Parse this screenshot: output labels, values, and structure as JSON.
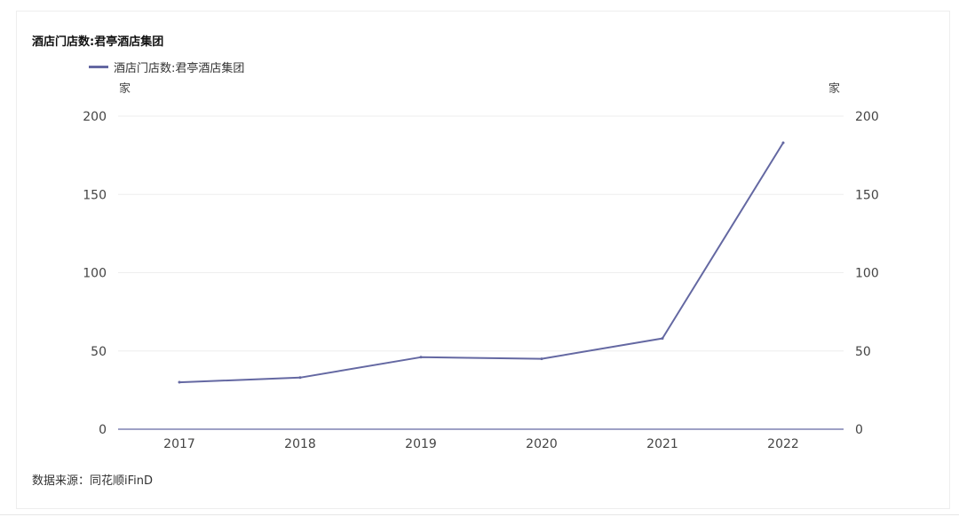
{
  "chart_data": {
    "type": "line",
    "title": "酒店门店数:君亭酒店集团",
    "xlabel": "",
    "ylabel_left": "家",
    "ylabel_right": "家",
    "categories": [
      "2017",
      "2018",
      "2019",
      "2020",
      "2021",
      "2022"
    ],
    "series": [
      {
        "name": "酒店门店数:君亭酒店集团",
        "values": [
          30,
          33,
          46,
          45,
          58,
          183
        ],
        "color": "#6468a2"
      }
    ],
    "ylim": [
      0,
      200
    ],
    "yticks": [
      0,
      50,
      100,
      150,
      200
    ],
    "grid": true,
    "legend": "top-left"
  },
  "source": "数据来源：同花顺iFinD",
  "colors": {
    "grid": "#eeeeee",
    "axis": "#6468a2"
  }
}
